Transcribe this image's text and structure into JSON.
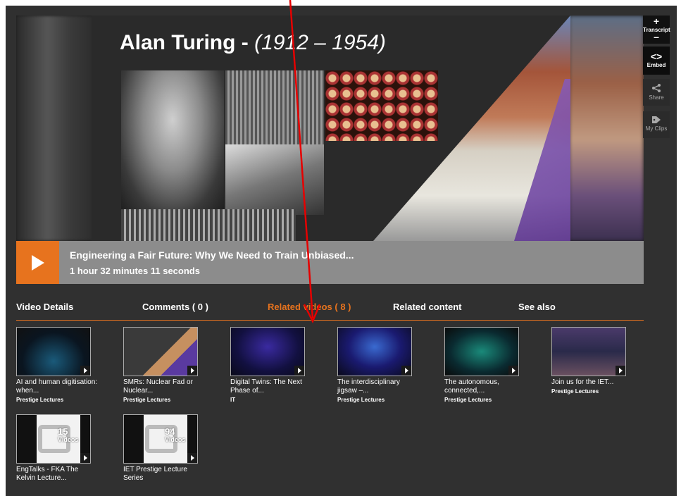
{
  "player": {
    "slide_title_name": "Alan Turing",
    "slide_title_sep": " - ",
    "slide_title_dates": "(1912 – 1954)",
    "video_title": "Engineering a Fair Future: Why We Need to Train Unbiased...",
    "duration": "1 hour 32 minutes 11 seconds"
  },
  "side_buttons": {
    "transcript_plus": "+",
    "transcript_label": "Transcript",
    "transcript_minus": "–",
    "embed_icon": "<>",
    "embed_label": "Embed",
    "share_label": "Share",
    "clips_label": "My Clips"
  },
  "tabs": {
    "details": "Video Details",
    "comments": "Comments",
    "comments_count": "( 0 )",
    "related_videos": "Related videos",
    "related_videos_count": "( 8 )",
    "related_content": "Related content",
    "see_also": "See also"
  },
  "videos": [
    {
      "title": "AI and human digitisation: when...",
      "category": "Prestige Lectures"
    },
    {
      "title": "SMRs: Nuclear Fad or Nuclear...",
      "category": "Prestige Lectures"
    },
    {
      "title": "Digital Twins: The Next Phase of...",
      "category": "IT"
    },
    {
      "title": "The interdisciplinary jigsaw –...",
      "category": "Prestige Lectures"
    },
    {
      "title": "The autonomous, connected,...",
      "category": "Prestige Lectures"
    },
    {
      "title": "Join us for the IET...",
      "category": "Prestige Lectures"
    }
  ],
  "playlists": [
    {
      "count": "15",
      "label": "Videos",
      "title": "EngTalks - FKA The Kelvin Lecture..."
    },
    {
      "count": "94",
      "label": "Videos",
      "title": "IET Prestige Lecture Series"
    }
  ],
  "colors": {
    "accent": "#e7731e",
    "background": "#303030",
    "annotation": "#e60000"
  }
}
